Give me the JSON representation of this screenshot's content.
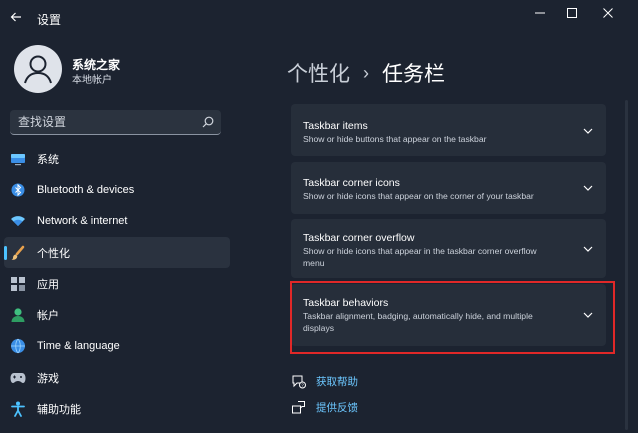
{
  "window": {
    "title": "设置",
    "controls": [
      "minimize-icon",
      "maximize-icon",
      "close-icon"
    ]
  },
  "profile": {
    "name": "系统之家",
    "subtitle": "本地帐户"
  },
  "search": {
    "placeholder": "查找设置",
    "icon": "search-icon"
  },
  "sidebar": {
    "items": [
      {
        "label": "系统",
        "icon": "system-monitor-icon"
      },
      {
        "label": "Bluetooth & devices",
        "icon": "bluetooth-icon"
      },
      {
        "label": "Network & internet",
        "icon": "wifi-icon"
      },
      {
        "label": "个性化",
        "icon": "paintbrush-icon",
        "active": true
      },
      {
        "label": "应用",
        "icon": "apps-icon"
      },
      {
        "label": "帐户",
        "icon": "account-icon"
      },
      {
        "label": "Time & language",
        "icon": "globe-clock-icon"
      },
      {
        "label": "游戏",
        "icon": "gamepad-icon"
      },
      {
        "label": "辅助功能",
        "icon": "accessibility-icon"
      }
    ]
  },
  "breadcrumb": {
    "parent": "个性化",
    "separator": "›",
    "current": "任务栏"
  },
  "cards": [
    {
      "title": "Taskbar items",
      "description": "Show or hide buttons that appear on the taskbar"
    },
    {
      "title": "Taskbar corner icons",
      "description": "Show or hide icons that appear on the corner of your taskbar"
    },
    {
      "title": "Taskbar corner overflow",
      "description": "Show or hide icons that appear in the taskbar corner overflow menu"
    },
    {
      "title": "Taskbar behaviors",
      "description": "Taskbar alignment, badging, automatically hide, and multiple displays",
      "highlighted": true
    }
  ],
  "help_links": [
    {
      "label": "获取帮助",
      "icon": "help-icon"
    },
    {
      "label": "提供反馈",
      "icon": "feedback-icon"
    }
  ],
  "colors": {
    "background": "#1c2330",
    "card": "#262e3a",
    "accent": "#4cc2ff",
    "link": "#6cc7ff",
    "highlight": "#e02828"
  }
}
